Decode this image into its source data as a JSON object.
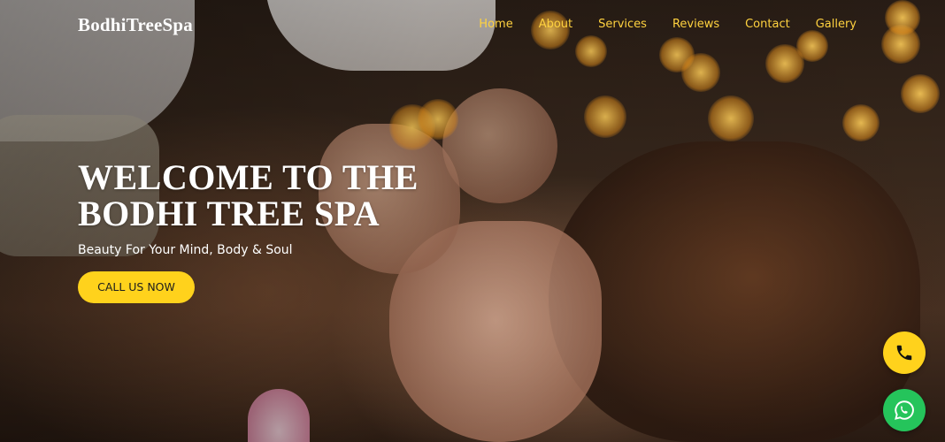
{
  "brand": {
    "name": "BodhiTreeSpa"
  },
  "nav": {
    "items": [
      {
        "label": "Home"
      },
      {
        "label": "About"
      },
      {
        "label": "Services"
      },
      {
        "label": "Reviews"
      },
      {
        "label": "Contact"
      },
      {
        "label": "Gallery"
      }
    ]
  },
  "hero": {
    "title_line1": "WELCOME TO THE",
    "title_line2": "BODHI TREE SPA",
    "subtitle": "Beauty For Your Mind, Body & Soul",
    "cta_label": "CALL US NOW"
  },
  "floating": {
    "call_icon": "phone-icon",
    "whatsapp_icon": "whatsapp-icon"
  },
  "colors": {
    "accent": "#ffd21c",
    "nav_link": "#ffd23f",
    "whatsapp": "#25c45b",
    "text_light": "#ffffff"
  }
}
